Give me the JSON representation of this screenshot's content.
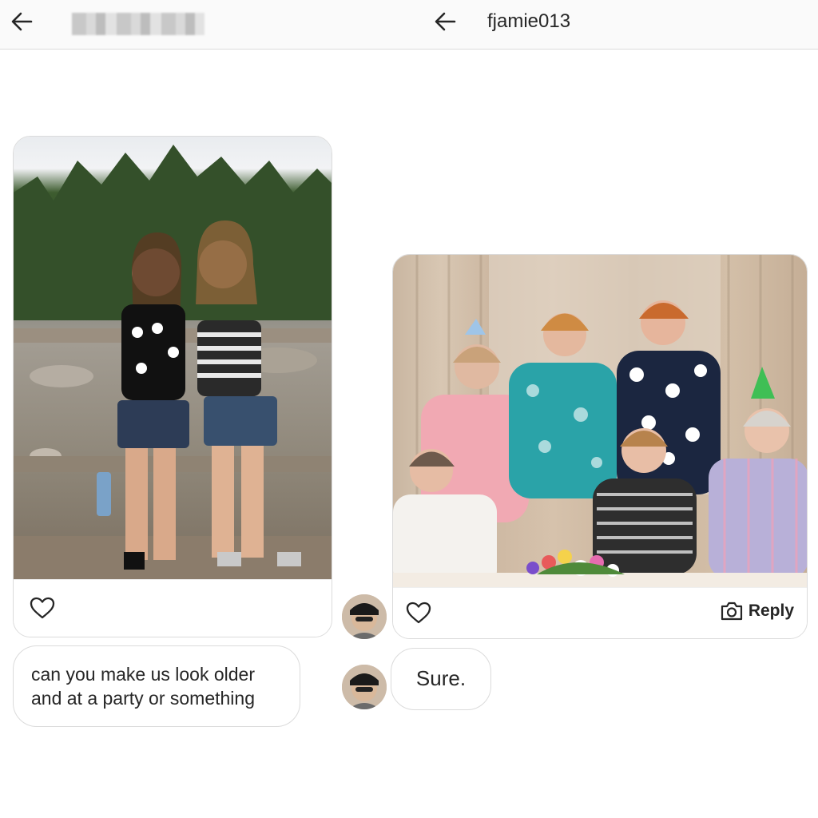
{
  "left_panel": {
    "header": {
      "back_icon": "arrow-left-icon",
      "username_redacted": true
    }
  },
  "right_panel": {
    "header": {
      "back_icon": "arrow-left-icon",
      "username": "fjamie013"
    }
  },
  "left_post": {
    "photo_desc_icon": "photo",
    "like_icon": "heart-icon"
  },
  "right_post": {
    "like_icon": "heart-icon",
    "reply_icon": "camera-icon",
    "reply_label": "Reply"
  },
  "messages": {
    "sent": "can you make us look older and at a party or something",
    "received": "Sure."
  },
  "colors": {
    "border": "#dbdbdb",
    "text": "#262626",
    "header_bg": "#fafafa"
  }
}
